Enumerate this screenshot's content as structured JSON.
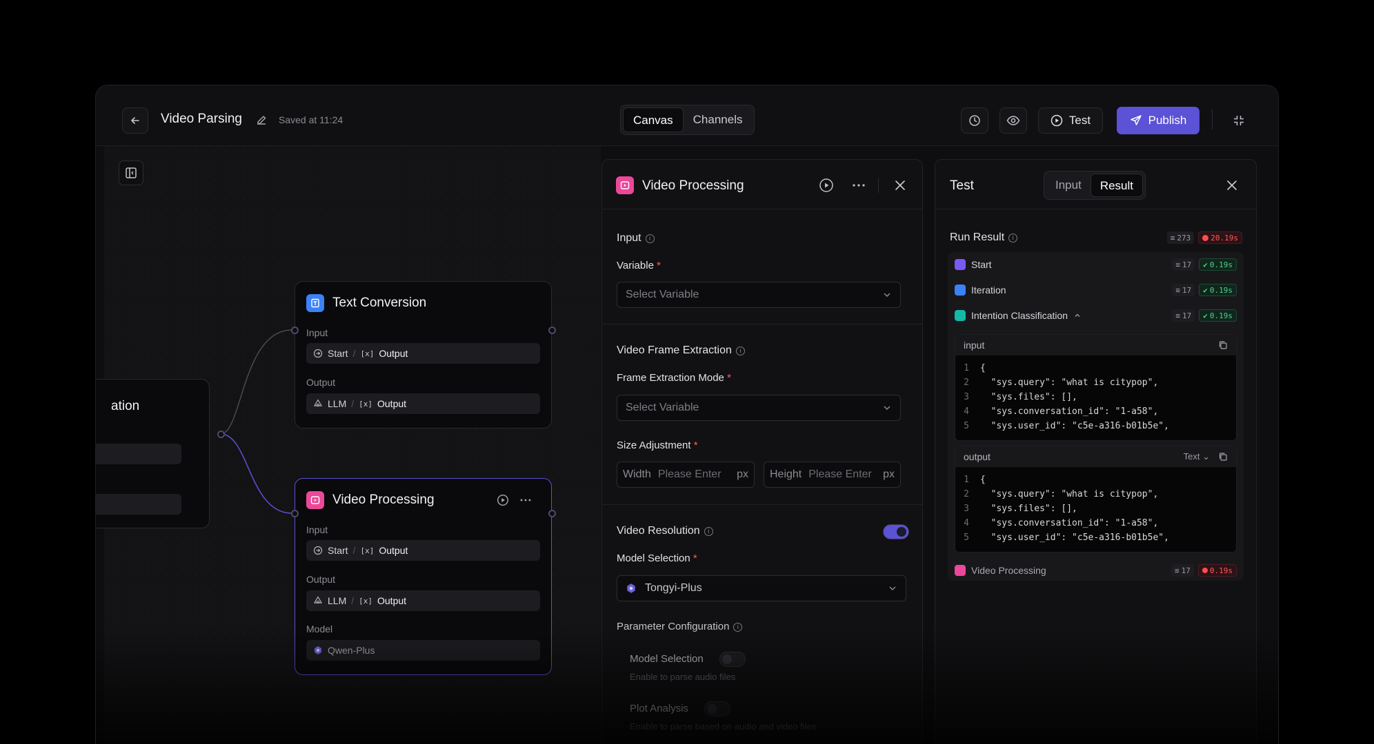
{
  "header": {
    "title": "Video Parsing",
    "saved": "Saved at 11:24",
    "tabs": [
      "Canvas",
      "Channels"
    ],
    "test_label": "Test",
    "publish_label": "Publish"
  },
  "canvas": {
    "partial_node_title": "ation",
    "text_conversion": {
      "title": "Text Conversion",
      "input_label": "Input",
      "input_src": "Start",
      "input_var": "Output",
      "output_label": "Output",
      "output_src": "LLM",
      "output_var": "Output"
    },
    "video_processing": {
      "title": "Video Processing",
      "input_label": "Input",
      "input_src": "Start",
      "input_var": "Output",
      "output_label": "Output",
      "output_src": "LLM",
      "output_var": "Output",
      "model_label": "Model",
      "model_value": "Qwen-Plus"
    }
  },
  "config": {
    "title": "Video Processing",
    "input_section": "Input",
    "variable_label": "Variable",
    "variable_placeholder": "Select Variable",
    "vfe_section": "Video Frame Extraction",
    "mode_label": "Frame Extraction Mode",
    "mode_placeholder": "Select Variable",
    "size_label": "Size Adjustment",
    "width_label": "Width",
    "height_label": "Height",
    "size_placeholder": "Please Enter",
    "unit": "px",
    "resolution_label": "Video Resolution",
    "model_selection_label": "Model Selection",
    "model_value": "Tongyi-Plus",
    "param_section": "Parameter Configuration",
    "param1_label": "Model Selection",
    "param1_desc": "Enable to parse audio files",
    "param2_label": "Plot Analysis",
    "param2_desc": "Enable to parse based on audio and video files"
  },
  "test": {
    "title": "Test",
    "tabs": [
      "Input",
      "Result"
    ],
    "run_result": "Run Result",
    "total_tokens": "273",
    "total_time": "20.19s",
    "rows": [
      {
        "name": "Start",
        "count": "17",
        "time": "0.19s",
        "status": "ok",
        "color": "#7a5af5"
      },
      {
        "name": "Iteration",
        "count": "17",
        "time": "0.19s",
        "status": "ok",
        "color": "#3b82f6"
      },
      {
        "name": "Intention Classification",
        "count": "17",
        "time": "0.19s",
        "status": "ok",
        "color": "#14b8a6"
      },
      {
        "name": "Video Processing",
        "count": "17",
        "time": "0.19s",
        "status": "error",
        "color": "#ec4899"
      }
    ],
    "input_block_label": "input",
    "output_block_label": "output",
    "output_format": "Text",
    "code_lines": [
      {
        "n": "1",
        "text": "{"
      },
      {
        "n": "2",
        "text": "  \"sys.query\": \"what is citypop\","
      },
      {
        "n": "3",
        "text": "  \"sys.files\": [],"
      },
      {
        "n": "4",
        "text": "  \"sys.conversation_id\": \"1-a58\","
      },
      {
        "n": "5",
        "text": "  \"sys.user_id\": \"c5e-a316-b01b5e\","
      }
    ]
  }
}
